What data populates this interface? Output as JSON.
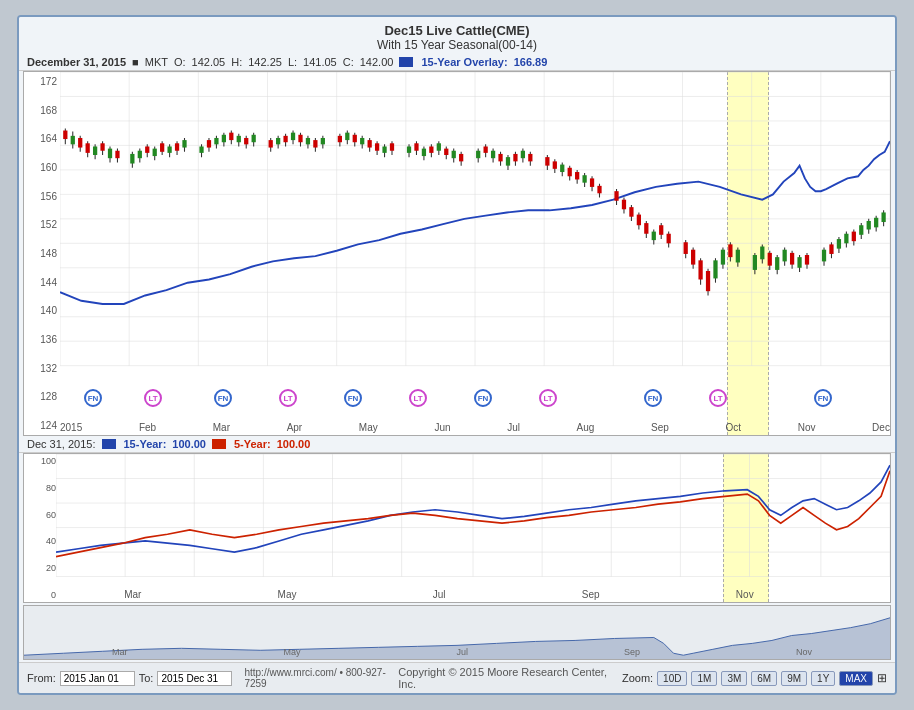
{
  "title": {
    "main": "Dec15 Live Cattle(CME)",
    "sub": "With 15 Year Seasonal(00-14)"
  },
  "main_info": {
    "date": "December 31, 2015",
    "mkt_label": "MKT",
    "o_label": "O:",
    "o_value": "142.05",
    "h_label": "H:",
    "h_value": "142.25",
    "l_label": "L:",
    "l_value": "141.05",
    "c_label": "C:",
    "c_value": "142.00",
    "overlay_label": "15-Year Overlay:",
    "overlay_value": "166.89"
  },
  "seasonal_info": {
    "date": "Dec 31, 2015:",
    "yr15_label": "15-Year:",
    "yr15_value": "100.00",
    "yr5_label": "5-Year:",
    "yr5_value": "100.00"
  },
  "y_axis_labels": [
    "172",
    "168",
    "164",
    "160",
    "156",
    "152",
    "148",
    "144",
    "140",
    "136",
    "132",
    "128",
    "124"
  ],
  "seasonal_y_labels": [
    "100",
    "80",
    "60",
    "40",
    "20",
    "0"
  ],
  "x_axis_labels": [
    "2015",
    "Feb",
    "Mar",
    "Apr",
    "May",
    "Jun",
    "Jul",
    "Aug",
    "Sep",
    "Oct",
    "Nov",
    "Dec"
  ],
  "mini_x_labels": [
    "Mar",
    "May",
    "Jul",
    "Sep",
    "Nov"
  ],
  "footer": {
    "from_label": "From:",
    "from_value": "2015 Jan 01",
    "to_label": "To:",
    "to_value": "2015 Dec 31",
    "zoom_label": "Zoom:",
    "zoom_buttons": [
      "10D",
      "1M",
      "3M",
      "6M",
      "9M",
      "1Y",
      "MAX"
    ],
    "active_zoom": "MAX",
    "copyright": "Copyright © 2015 Moore Research Center, Inc.",
    "website": "http://www.mrci.com/ • 800-927-7259"
  }
}
